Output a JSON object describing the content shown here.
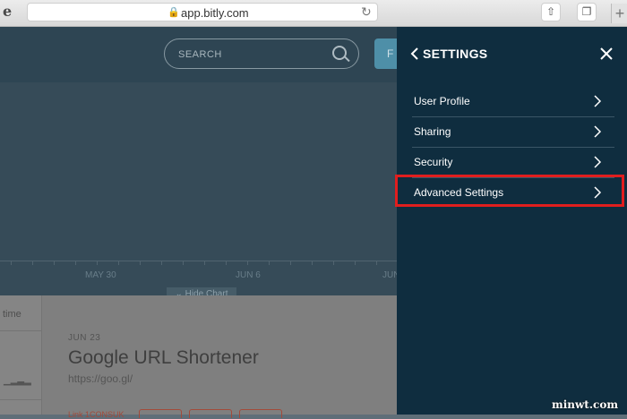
{
  "browser": {
    "url": "app.bitly.com",
    "back_icon": "ie-icon",
    "share_icon": "share-icon",
    "tabs_icon": "tabs-icon",
    "new_tab": "+"
  },
  "header": {
    "search_placeholder": "SEARCH",
    "button_label": "F"
  },
  "chart": {
    "x_ticks": [
      "MAY 30",
      "JUN 6",
      "JUN"
    ],
    "hide_label": "Hide Chart"
  },
  "links": {
    "sidebar_label": "time",
    "date": "JUN 23",
    "title": "Google URL Shortener",
    "url": "https://goo.gl/",
    "tag_text": "Link 1CONSUK"
  },
  "settings": {
    "title": "SETTINGS",
    "items": [
      {
        "label": "User Profile"
      },
      {
        "label": "Sharing"
      },
      {
        "label": "Security"
      },
      {
        "label": "Advanced Settings"
      }
    ],
    "highlight_color": "#e01e1e"
  },
  "watermark": "minwt.com"
}
